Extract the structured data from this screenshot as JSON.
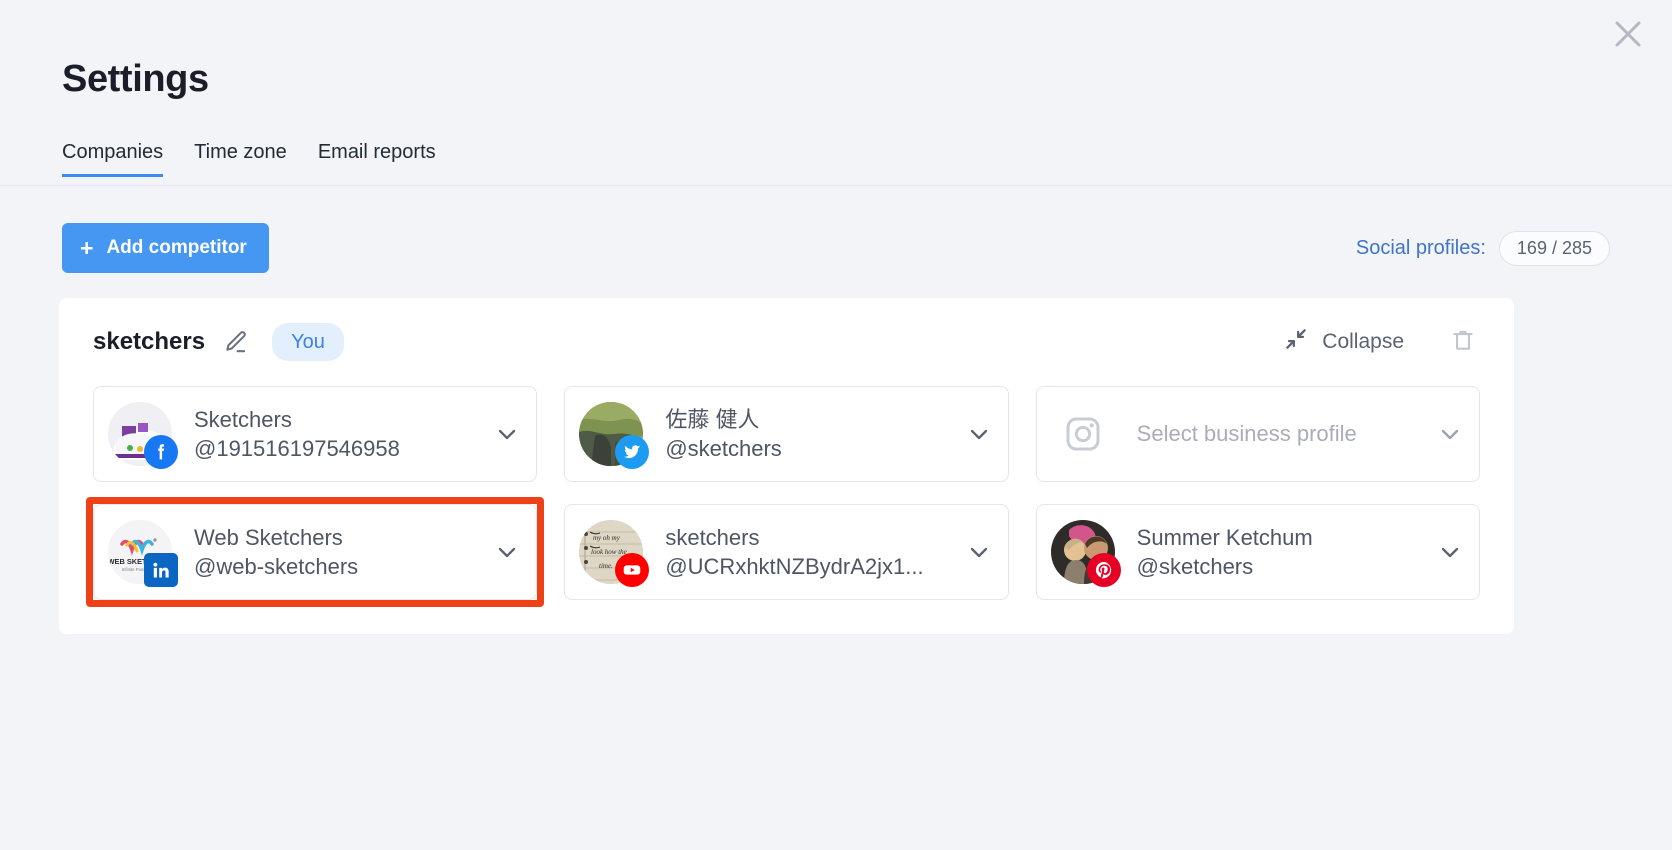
{
  "window": {
    "close_icon": "close-icon"
  },
  "header": {
    "title": "Settings",
    "tabs": [
      {
        "label": "Companies",
        "active": true
      },
      {
        "label": "Time zone",
        "active": false
      },
      {
        "label": "Email reports",
        "active": false
      }
    ]
  },
  "toolbar": {
    "add_competitor_label": "Add competitor",
    "add_competitor_plus": "+",
    "social_profiles_label": "Social profiles:",
    "social_profiles_count": "169 / 285"
  },
  "company": {
    "name": "sketchers",
    "edit_icon": "pencil-icon",
    "owner_chip": "You",
    "collapse_label": "Collapse",
    "collapse_icon": "collapse-arrows-icon",
    "delete_icon": "trash-icon"
  },
  "profiles": [
    {
      "network": "facebook",
      "title": "Sketchers",
      "handle": "@191516197546958",
      "empty": false,
      "highlighted": false,
      "badge_color": "#1877f2"
    },
    {
      "network": "twitter",
      "title": "佐藤 健人",
      "handle": "@sketchers",
      "empty": false,
      "highlighted": false,
      "badge_color": "#1d9bf0"
    },
    {
      "network": "instagram",
      "title": "",
      "handle": "",
      "placeholder": "Select business profile",
      "empty": true,
      "highlighted": false,
      "badge_color": "#c9ccd4"
    },
    {
      "network": "linkedin",
      "title": "Web Sketchers",
      "handle": "@web-sketchers",
      "empty": false,
      "highlighted": true,
      "badge_color": "#0a66c2"
    },
    {
      "network": "youtube",
      "title": "sketchers",
      "handle": "@UCRxhktNZBydrA2jx1...",
      "empty": false,
      "highlighted": false,
      "badge_color": "#ff0000"
    },
    {
      "network": "pinterest",
      "title": "Summer Ketchum",
      "handle": "@sketchers",
      "empty": false,
      "highlighted": false,
      "badge_color": "#e60023"
    }
  ],
  "colors": {
    "background": "#f2f4f7",
    "panel": "#ffffff",
    "accent_blue": "#4597f1",
    "link_blue": "#3f74c9",
    "highlight_red": "#ef4117",
    "text_primary": "#1b1e28",
    "text_secondary": "#4e5664"
  }
}
